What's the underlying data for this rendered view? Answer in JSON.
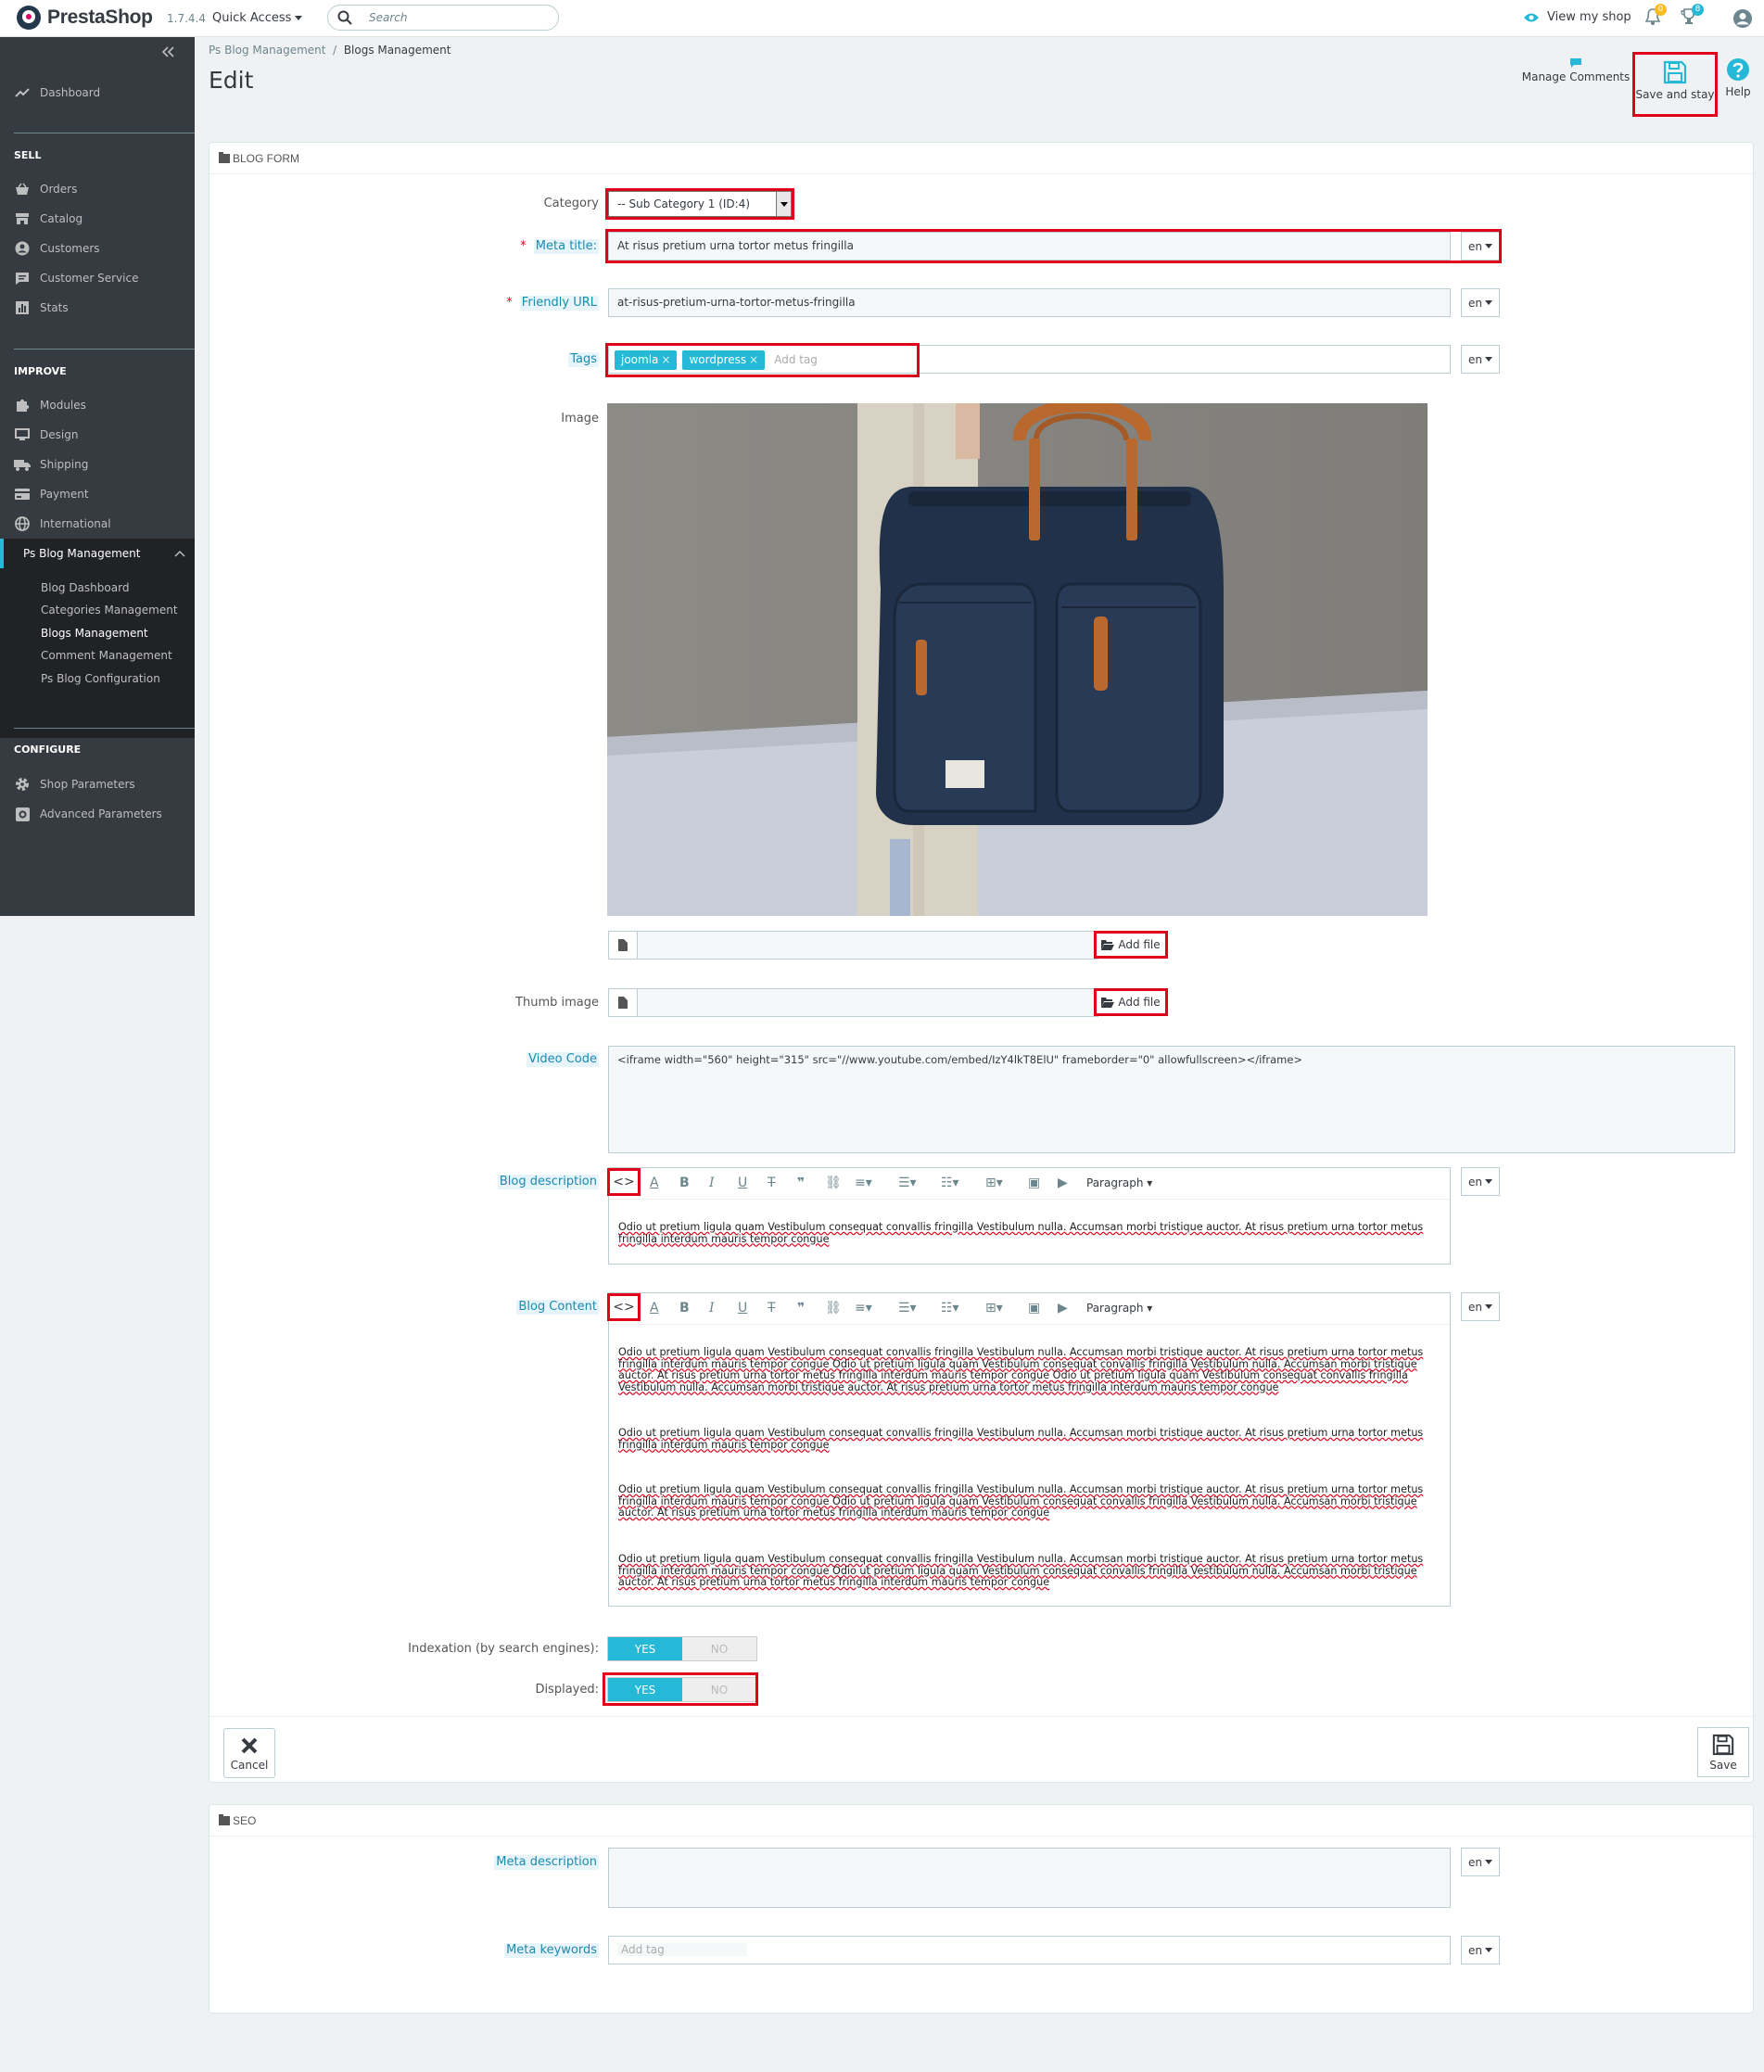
{
  "topbar": {
    "brand": "PrestaShop",
    "version": "1.7.4.4",
    "quick_access": "Quick Access",
    "search_placeholder": "Search",
    "view_shop": "View my shop",
    "notif_count": "0",
    "orders_count": "8"
  },
  "sidebar": {
    "dashboard": "Dashboard",
    "sell": "SELL",
    "sell_items": [
      "Orders",
      "Catalog",
      "Customers",
      "Customer Service",
      "Stats"
    ],
    "improve": "IMPROVE",
    "improve_items": [
      "Modules",
      "Design",
      "Shipping",
      "Payment",
      "International"
    ],
    "active": "Ps Blog Management",
    "sub_items": [
      "Blog Dashboard",
      "Categories Management",
      "Blogs Management",
      "Comment Management",
      "Ps Blog Configuration"
    ],
    "configure": "CONFIGURE",
    "configure_items": [
      "Shop Parameters",
      "Advanced Parameters"
    ]
  },
  "header": {
    "crumb_1": "Ps Blog Management",
    "crumb_sep": "/",
    "crumb_2": "Blogs Management",
    "title": "Edit",
    "manage_comments": "Manage Comments",
    "save_stay": "Save and stay",
    "help": "Help"
  },
  "form": {
    "heading": "BLOG FORM",
    "category_label": "Category",
    "category_value": "-- Sub Category 1 (ID:4)",
    "meta_title_label": "Meta title:",
    "meta_title_value": "At risus pretium urna tortor metus fringilla",
    "friendly_url_label": "Friendly URL",
    "friendly_url_value": "at-risus-pretium-urna-tortor-metus-fringilla",
    "tags_label": "Tags",
    "tags": [
      "joomla",
      "wordpress"
    ],
    "tag_placeholder": "Add tag",
    "lang": "en",
    "image_label": "Image",
    "add_file": "Add file",
    "thumb_label": "Thumb image",
    "video_label": "Video Code",
    "video_value": "<iframe width=\"560\" height=\"315\" src=\"//www.youtube.com/embed/IzY4lkT8ElU\" frameborder=\"0\" allowfullscreen></iframe>",
    "desc_label": "Blog description",
    "paragraph": "Paragraph",
    "desc_text": "Odio ut pretium ligula quam Vestibulum consequat convallis fringilla Vestibulum nulla. Accumsan morbi tristique auctor. At risus pretium urna tortor metus fringilla interdum mauris tempor congue",
    "content_label": "Blog Content",
    "content_p1": "Odio ut pretium ligula quam Vestibulum consequat convallis fringilla Vestibulum nulla. Accumsan morbi tristique auctor. At risus pretium urna tortor metus fringilla interdum mauris tempor congue Odio ut pretium ligula quam Vestibulum consequat convallis fringilla Vestibulum nulla. Accumsan morbi tristique auctor. At risus pretium urna tortor metus fringilla interdum mauris tempor congue Odio ut pretium ligula quam Vestibulum consequat convallis fringilla Vestibulum nulla. Accumsan morbi tristique auctor. At risus pretium urna tortor metus fringilla interdum mauris tempor congue",
    "content_p2": "Odio ut pretium ligula quam Vestibulum consequat convallis fringilla Vestibulum nulla. Accumsan morbi tristique auctor. At risus pretium urna tortor metus fringilla interdum mauris tempor congue",
    "content_p3": "Odio ut pretium ligula quam Vestibulum consequat convallis fringilla Vestibulum nulla. Accumsan morbi tristique auctor. At risus pretium urna tortor metus fringilla interdum mauris tempor congue Odio ut pretium ligula quam Vestibulum consequat convallis fringilla Vestibulum nulla. Accumsan morbi tristique auctor. At risus pretium urna tortor metus fringilla interdum mauris tempor congue",
    "content_p4": "Odio ut pretium ligula quam Vestibulum consequat convallis fringilla Vestibulum nulla. Accumsan morbi tristique auctor. At risus pretium urna tortor metus fringilla interdum mauris tempor congue Odio ut pretium ligula quam Vestibulum consequat convallis fringilla Vestibulum nulla. Accumsan morbi tristique auctor. At risus pretium urna tortor metus fringilla interdum mauris tempor congue",
    "index_label": "Indexation (by search engines):",
    "displayed_label": "Displayed:",
    "yes": "YES",
    "no": "NO",
    "cancel": "Cancel",
    "save": "Save"
  },
  "seo": {
    "heading": "SEO",
    "meta_desc_label": "Meta description",
    "meta_kw_label": "Meta keywords",
    "kw_placeholder": "Add tag"
  },
  "colors": {
    "accent": "#25b9d7",
    "sidebar": "#363a41",
    "highlight": "#e0001a"
  }
}
